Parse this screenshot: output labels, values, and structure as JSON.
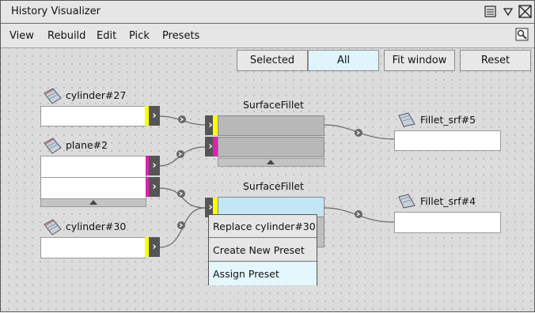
{
  "window": {
    "title": "History Visualizer"
  },
  "menu": [
    "View",
    "Rebuild",
    "Edit",
    "Pick",
    "Presets"
  ],
  "toolbar": {
    "selected": "Selected",
    "all": "All",
    "fit": "Fit window",
    "reset": "Reset",
    "active": "All"
  },
  "nodes": {
    "cylinder27": "cylinder#27",
    "plane2": "plane#2",
    "cylinder30": "cylinder#30",
    "fillet1": "SurfaceFillet",
    "fillet2": "SurfaceFillet",
    "out1": "Fillet_srf#5",
    "out2": "Fillet_srf#4"
  },
  "context_menu": {
    "items": [
      "Replace cylinder#30",
      "Create New Preset",
      "Assign Preset"
    ],
    "highlighted": "Assign Preset"
  },
  "colors": {
    "yellow": "#ffff00",
    "magenta": "#e020b0",
    "selected_node": "#c2e6f5",
    "accent": "#dff4fb"
  }
}
